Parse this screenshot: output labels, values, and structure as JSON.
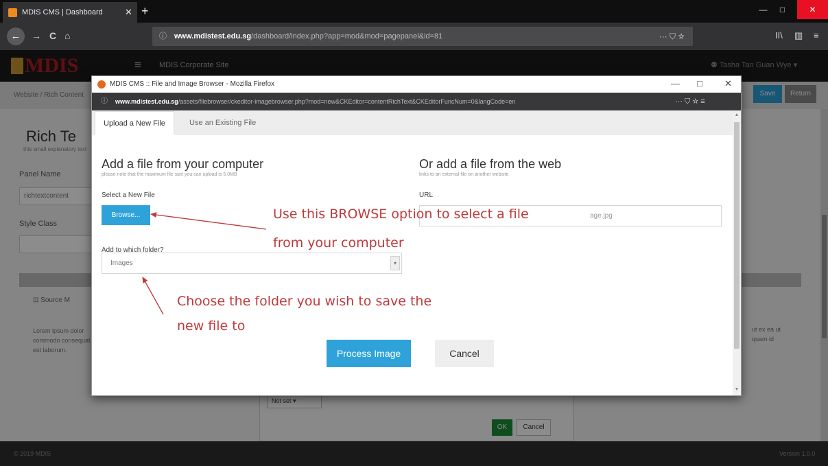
{
  "browser": {
    "tab_title": "MDIS CMS | Dashboard",
    "tab_close": "✕",
    "new_tab": "+",
    "url_host": "www.mdistest.edu.sg",
    "url_path": "/dashboard/index.php?app=mod&mod=pagepanel&id=81",
    "url_icons": "··· ⛉ ☆",
    "back_icon": "←",
    "forward_icon": "→",
    "reload_icon": "C",
    "home_icon": "⌂",
    "info_icon": "ⓘ",
    "library_icon": "II\\",
    "sidebar_icon": "▥",
    "menu_icon": "≡",
    "minimize": "—",
    "maximize": "□",
    "close": "✕"
  },
  "cms": {
    "logo": "MDIS",
    "menu_icon": "≡",
    "site_name": "MDIS Corporate Site",
    "user": "⚉ Tasha Tan Guan Wye ▾",
    "breadcrumb": "Website / Rich Content",
    "save_label": "Save",
    "return_label": "Return",
    "page_title": "Rich Te",
    "page_subtitle": "this small explanatory text",
    "panel_name_label": "Panel Name",
    "panel_name_value": "richtextcontent",
    "style_class_label": "Style Class",
    "source_button": "⊡ Source  M",
    "lorem_left": "Lorem ipsum dolor commodo consequat est laborum.",
    "lorem_right": "ut ex ea ut quam id",
    "under_select": "Not set ▾",
    "under_ok": "OK",
    "under_cancel": "Cancel",
    "footer_left": "© 2019 MDIS",
    "footer_right": "Version 1.0.0"
  },
  "popup": {
    "title": "MDIS CMS :: File and Image Browser - Mozilla Firefox",
    "minimize": "—",
    "maximize": "□",
    "close": "✕",
    "info_icon": "ⓘ",
    "url_host": "www.mdistest.edu.sg",
    "url_path": "/assets/filebrowser/ckeditor-imagebrowser.php?mod=new&CKEditor=contentRichText&CKEditorFuncNum=0&langCode=en",
    "url_icons": "···  ⛉  ☆  ≡",
    "tabs": [
      {
        "label": "Upload a New File"
      },
      {
        "label": "Use an Existing File"
      }
    ],
    "left_heading": "Add a file from your computer",
    "left_subtext": "please note that the maximum file size you can upload is 5.0MB",
    "right_heading": "Or add a file from the web",
    "right_subtext": "links to an external file on another website",
    "select_label": "Select a New File",
    "browse_label": "Browse...",
    "url_label": "URL",
    "url_ghost": "age.jpg",
    "folder_label": "Add to which folder?",
    "folder_value": "Images",
    "folder_arrow": "▾",
    "process_label": "Process Image",
    "cancel_label": "Cancel",
    "scroll_up": "▲",
    "scroll_down": "▼"
  },
  "annotations": {
    "browse_line1": "Use this BROWSE option to select a file",
    "browse_line2": "from your computer",
    "folder_line1": "Choose the folder you wish to save the",
    "folder_line2": "new file to",
    "color": "#c0393b"
  }
}
